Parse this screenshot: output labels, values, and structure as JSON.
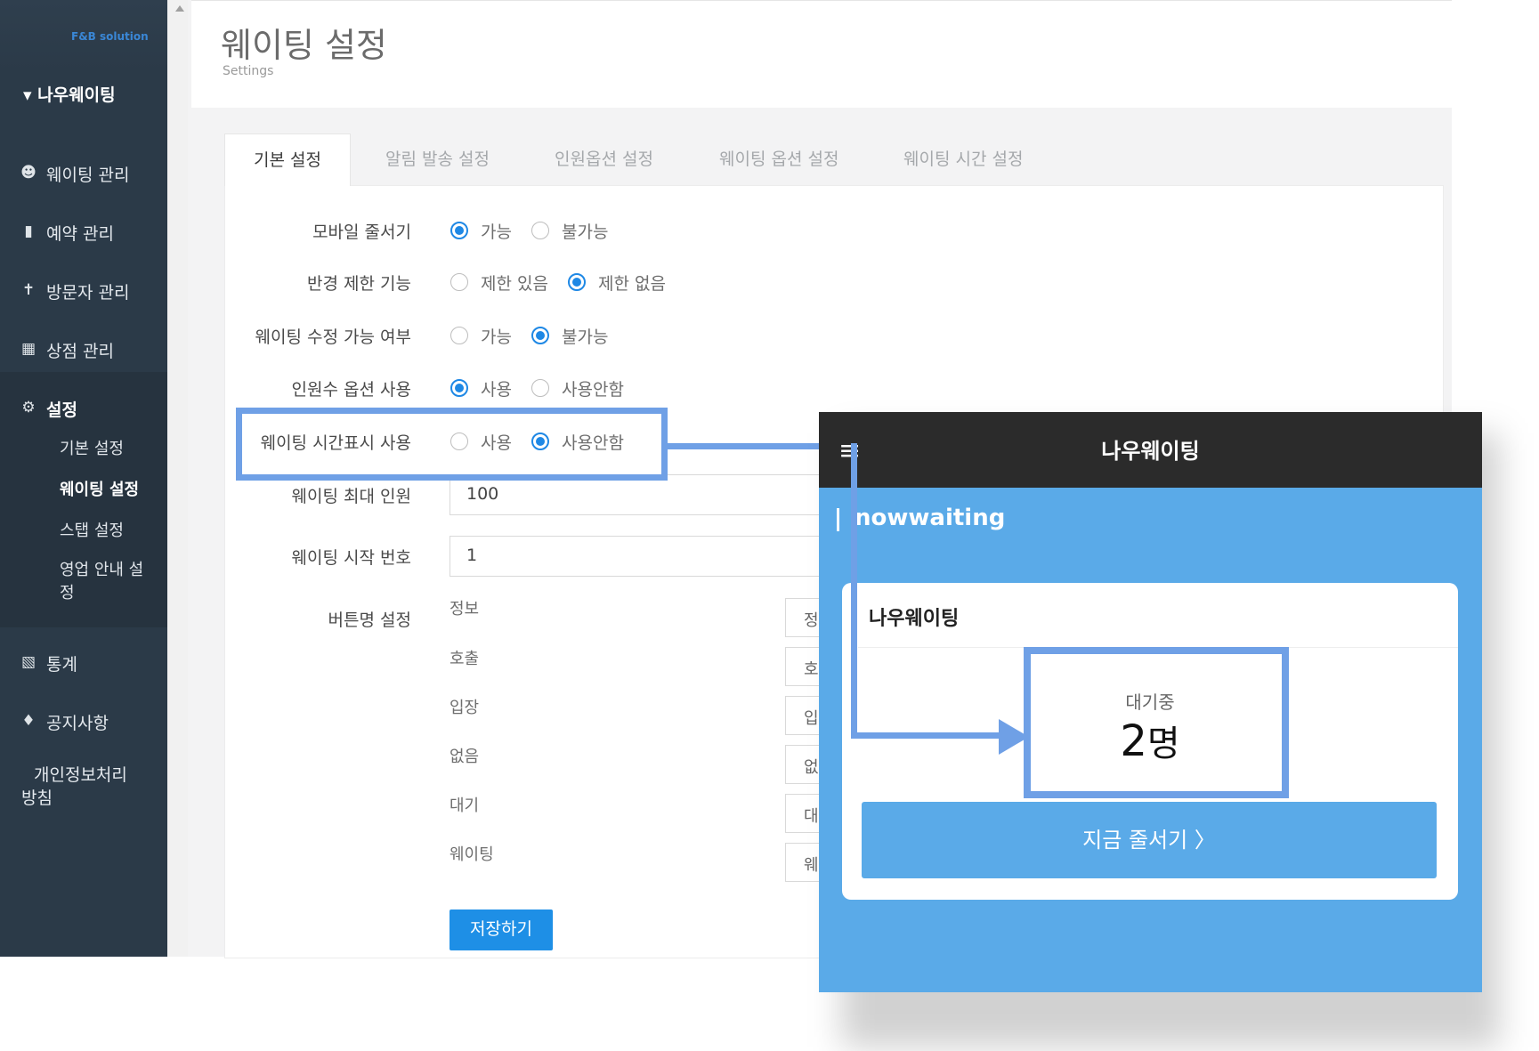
{
  "sidebar": {
    "logo_text": "F&B solution",
    "brand": "나우웨이팅",
    "items": [
      {
        "label": "웨이팅 관리",
        "icon": "users-icon"
      },
      {
        "label": "예약 관리",
        "icon": "bookmark-icon"
      },
      {
        "label": "방문자 관리",
        "icon": "visitor-icon"
      },
      {
        "label": "상점 관리",
        "icon": "building-icon"
      },
      {
        "label": "설정",
        "icon": "gear-icon"
      },
      {
        "label": "통계",
        "icon": "chart-icon"
      },
      {
        "label": "공지사항",
        "icon": "bell-icon"
      }
    ],
    "settings_sub": [
      "기본 설정",
      "웨이팅 설정",
      "스탭 설정",
      "영업 안내 설정"
    ],
    "privacy_line1": "개인정보처리",
    "privacy_line2": "방침"
  },
  "header": {
    "title": "웨이팅 설정",
    "subtitle": "Settings"
  },
  "tabs": [
    "기본 설정",
    "알림 발송 설정",
    "인원옵션 설정",
    "웨이팅 옵션 설정",
    "웨이팅 시간 설정"
  ],
  "form": {
    "mobile_queue": {
      "label": "모바일 줄서기",
      "opt1": "가능",
      "opt2": "불가능",
      "selected": 1
    },
    "radius_limit": {
      "label": "반경 제한 기능",
      "opt1": "제한 있음",
      "opt2": "제한 없음",
      "selected": 2
    },
    "edit_allowed": {
      "label": "웨이팅 수정 가능 여부",
      "opt1": "가능",
      "opt2": "불가능",
      "selected": 2
    },
    "party_option": {
      "label": "인원수 옵션 사용",
      "opt1": "사용",
      "opt2": "사용안함",
      "selected": 1
    },
    "time_display": {
      "label": "웨이팅 시간표시 사용",
      "opt1": "사용",
      "opt2": "사용안함",
      "selected": 2
    },
    "max_people": {
      "label": "웨이팅 최대 인원",
      "value": "100"
    },
    "start_number": {
      "label": "웨이팅 시작 번호",
      "value": "1"
    },
    "button_names": {
      "label": "버튼명 설정",
      "rows": [
        {
          "name": "정보",
          "value": "정"
        },
        {
          "name": "호출",
          "value": "호"
        },
        {
          "name": "입장",
          "value": "입"
        },
        {
          "name": "없음",
          "value": "없"
        },
        {
          "name": "대기",
          "value": "대"
        },
        {
          "name": "웨이팅",
          "value": "웨"
        }
      ]
    },
    "save_label": "저장하기"
  },
  "phone": {
    "menu_icon": "≡",
    "title": "나우웨이팅",
    "logo": "nowwaiting",
    "store_name": "나우웨이팅",
    "wait_label": "대기중",
    "wait_count": "2",
    "wait_unit": "명",
    "cta": "지금 줄서기 〉"
  },
  "colors": {
    "sidebar": "#2b3a48",
    "accent": "#1e88e5",
    "highlight": "#6fa0e6",
    "phone_bg": "#5aaae8"
  }
}
